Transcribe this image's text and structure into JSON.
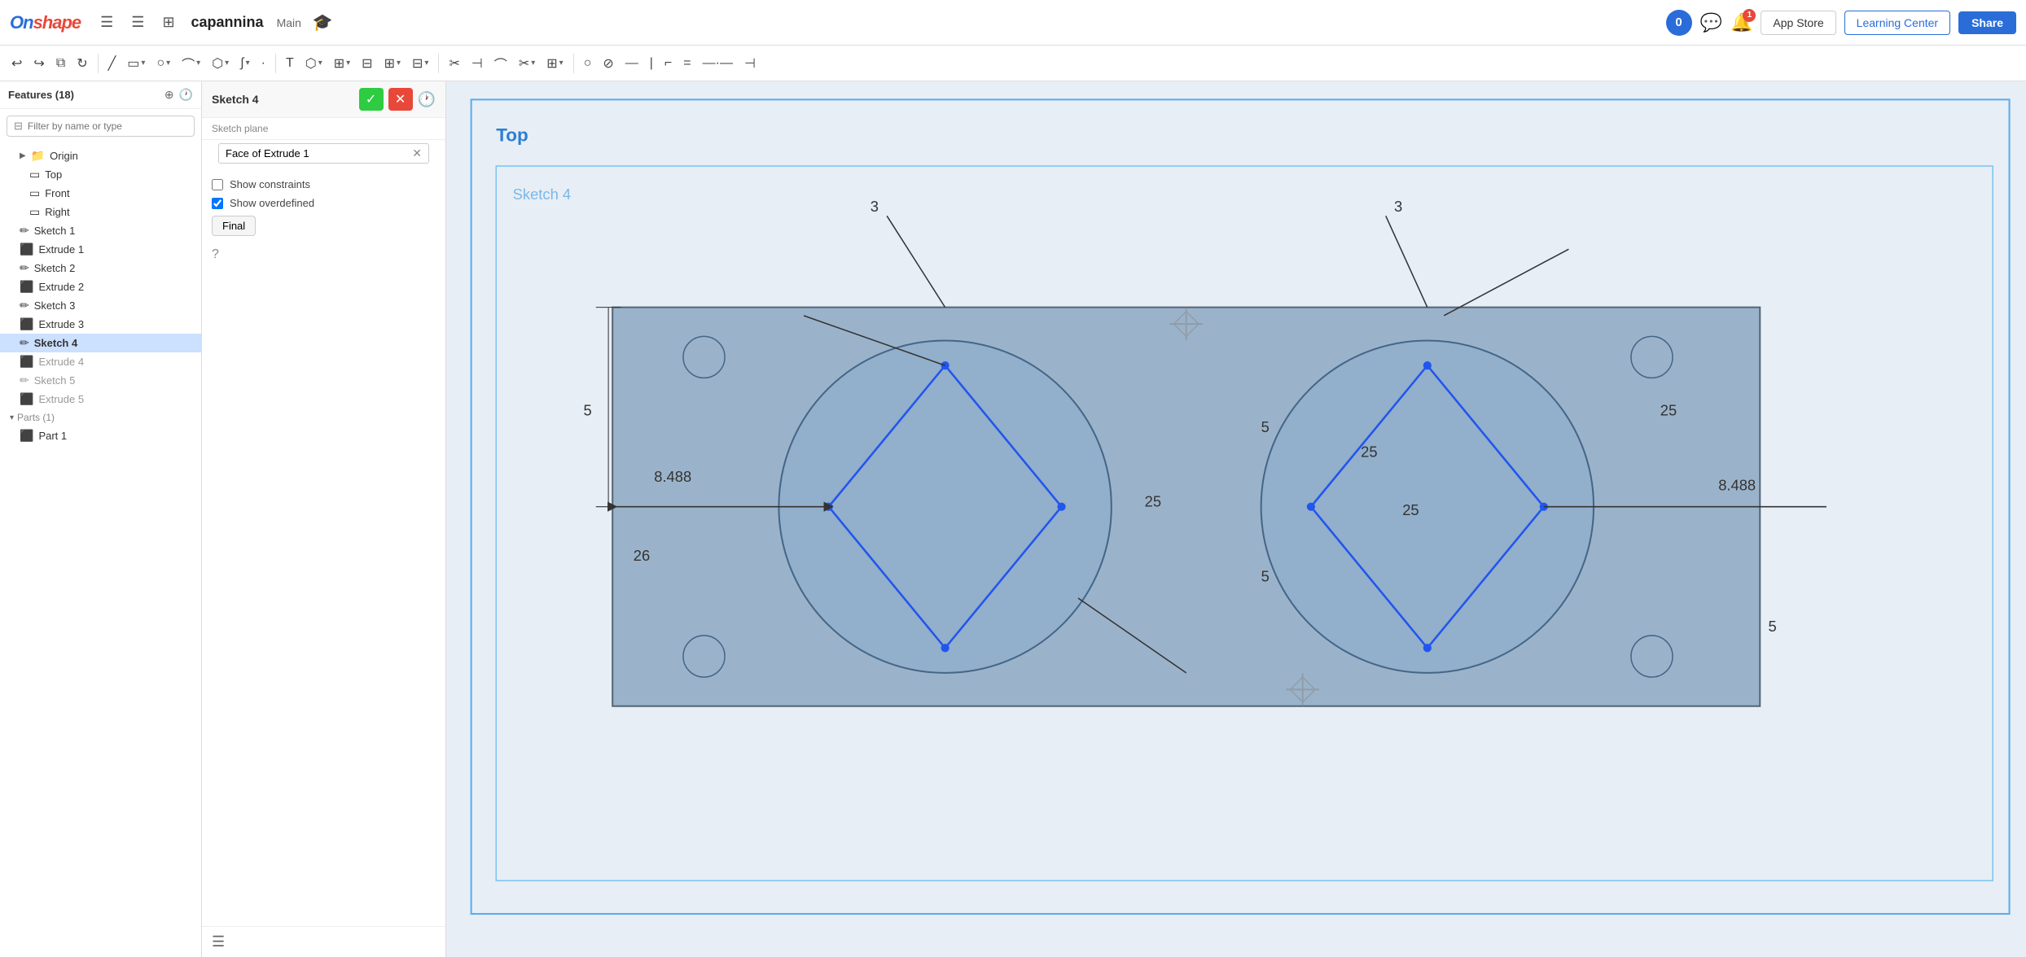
{
  "app": {
    "logo": "Onshape",
    "project_name": "capannina",
    "branch": "Main"
  },
  "topnav": {
    "appstore_label": "App Store",
    "learning_label": "Learning Center",
    "share_label": "Share",
    "notif_count": "1",
    "counter_value": "0"
  },
  "sidebar": {
    "title": "Features (18)",
    "search_placeholder": "Filter by name or type",
    "items": [
      {
        "label": "Origin",
        "type": "folder",
        "indent": 2,
        "arrow": true,
        "dimmed": false
      },
      {
        "label": "Top",
        "type": "plane",
        "indent": 2,
        "dimmed": false
      },
      {
        "label": "Front",
        "type": "plane",
        "indent": 2,
        "dimmed": false
      },
      {
        "label": "Right",
        "type": "plane",
        "indent": 2,
        "dimmed": false
      },
      {
        "label": "Sketch 1",
        "type": "sketch",
        "indent": 1,
        "dimmed": false
      },
      {
        "label": "Extrude 1",
        "type": "extrude",
        "indent": 1,
        "dimmed": false
      },
      {
        "label": "Sketch 2",
        "type": "sketch",
        "indent": 1,
        "dimmed": false
      },
      {
        "label": "Extrude 2",
        "type": "extrude",
        "indent": 1,
        "dimmed": false
      },
      {
        "label": "Sketch 3",
        "type": "sketch",
        "indent": 1,
        "dimmed": false
      },
      {
        "label": "Extrude 3",
        "type": "extrude",
        "indent": 1,
        "dimmed": false
      },
      {
        "label": "Sketch 4",
        "type": "sketch",
        "indent": 1,
        "active": true,
        "dimmed": false
      },
      {
        "label": "Extrude 4",
        "type": "extrude",
        "indent": 1,
        "dimmed": true
      },
      {
        "label": "Sketch 5",
        "type": "sketch",
        "indent": 1,
        "dimmed": true
      },
      {
        "label": "Extrude 5",
        "type": "extrude",
        "indent": 1,
        "dimmed": true
      }
    ],
    "parts_section": "Parts (1)",
    "part1": "Part 1"
  },
  "sketch_panel": {
    "title": "Sketch 4",
    "confirm_label": "✓",
    "cancel_label": "✕",
    "plane_label": "Sketch plane",
    "plane_value": "Face of Extrude 1",
    "show_constraints_label": "Show constraints",
    "show_constraints_checked": false,
    "show_overdefined_label": "Show overdefined",
    "show_overdefined_checked": true,
    "final_button": "Final"
  },
  "viewport": {
    "top_label": "Top",
    "sketch_label": "Sketch 4",
    "dimensions": {
      "val1": "3",
      "val2": "3",
      "val3": "5",
      "val4": "5",
      "val5": "5",
      "val6": "5",
      "val7": "25",
      "val8": "25",
      "val9": "25",
      "val10": "25",
      "val11": "8.488",
      "val12": "8.488"
    }
  }
}
